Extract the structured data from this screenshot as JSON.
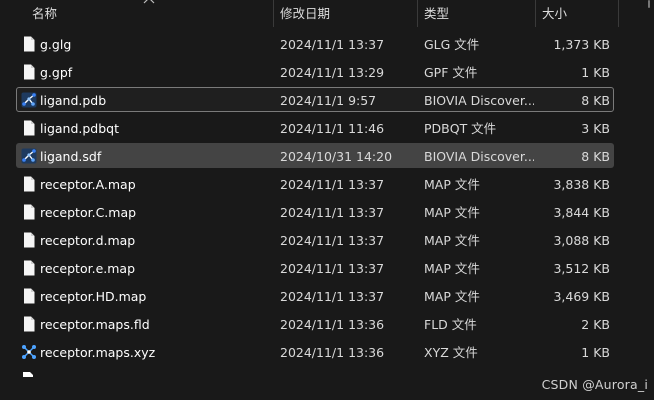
{
  "columns": {
    "name": "名称",
    "modified": "修改日期",
    "type": "类型",
    "size": "大小"
  },
  "files": [
    {
      "name": "g.glg",
      "modified": "2024/11/1 13:37",
      "type": "GLG 文件",
      "size": "1,373 KB",
      "icon": "file-icon",
      "state": "normal"
    },
    {
      "name": "g.gpf",
      "modified": "2024/11/1 13:29",
      "type": "GPF 文件",
      "size": "1 KB",
      "icon": "file-icon",
      "state": "normal"
    },
    {
      "name": "ligand.pdb",
      "modified": "2024/11/1 9:57",
      "type": "BIOVIA Discover...",
      "size": "8 KB",
      "icon": "biovia-molecule-icon",
      "state": "focused"
    },
    {
      "name": "ligand.pdbqt",
      "modified": "2024/11/1 11:46",
      "type": "PDBQT 文件",
      "size": "3 KB",
      "icon": "file-icon",
      "state": "normal"
    },
    {
      "name": "ligand.sdf",
      "modified": "2024/10/31 14:20",
      "type": "BIOVIA Discover...",
      "size": "8 KB",
      "icon": "biovia-molecule-icon",
      "state": "selected"
    },
    {
      "name": "receptor.A.map",
      "modified": "2024/11/1 13:37",
      "type": "MAP 文件",
      "size": "3,838 KB",
      "icon": "file-icon",
      "state": "normal"
    },
    {
      "name": "receptor.C.map",
      "modified": "2024/11/1 13:37",
      "type": "MAP 文件",
      "size": "3,844 KB",
      "icon": "file-icon",
      "state": "normal"
    },
    {
      "name": "receptor.d.map",
      "modified": "2024/11/1 13:37",
      "type": "MAP 文件",
      "size": "3,088 KB",
      "icon": "file-icon",
      "state": "normal"
    },
    {
      "name": "receptor.e.map",
      "modified": "2024/11/1 13:37",
      "type": "MAP 文件",
      "size": "3,512 KB",
      "icon": "file-icon",
      "state": "normal"
    },
    {
      "name": "receptor.HD.map",
      "modified": "2024/11/1 13:37",
      "type": "MAP 文件",
      "size": "3,469 KB",
      "icon": "file-icon",
      "state": "normal"
    },
    {
      "name": "receptor.maps.fld",
      "modified": "2024/11/1 13:36",
      "type": "FLD 文件",
      "size": "2 KB",
      "icon": "file-icon",
      "state": "normal"
    },
    {
      "name": "receptor.maps.xyz",
      "modified": "2024/11/1 13:36",
      "type": "XYZ 文件",
      "size": "1 KB",
      "icon": "xyz-molecule-icon",
      "state": "normal"
    }
  ],
  "watermark": "CSDN @Aurora_i",
  "colors": {
    "background": "#191919",
    "selected_row": "#444444",
    "focus_border": "#7a7a7a",
    "biovia_icon": "#3b82f6"
  }
}
